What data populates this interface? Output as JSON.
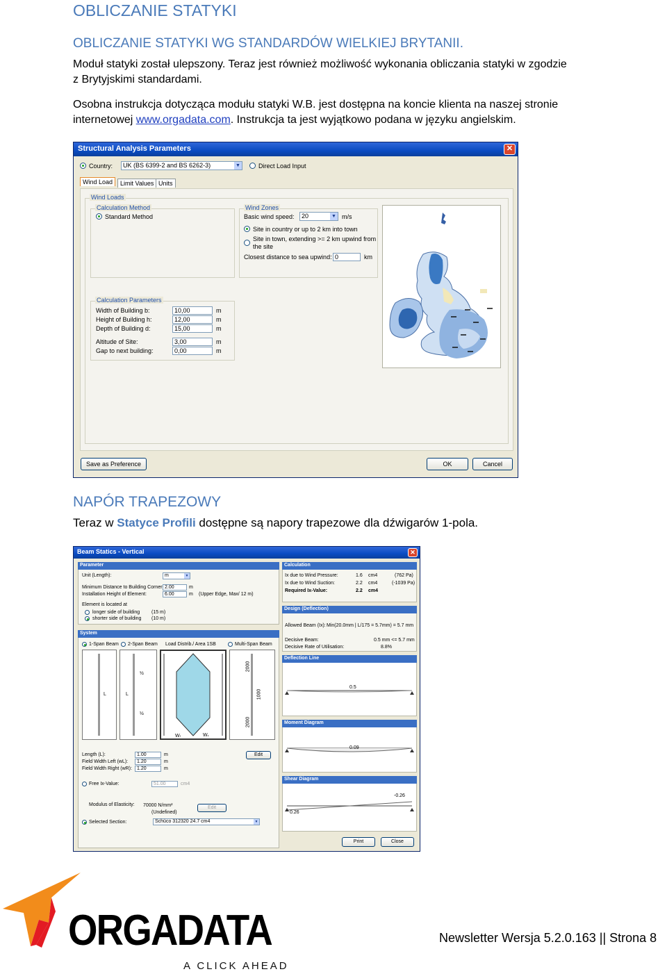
{
  "heading": "OBLICZANIE STATYKI",
  "subheading": "OBLICZANIE STATYKI WG STANDARDÓW WIELKIEJ BRYTANII.",
  "para1_line1": "Moduł statyki został ulepszony. Teraz jest również możliwość wykonania obliczania statyki w zgodzie",
  "para1_line2": "z Brytyjskimi standardami.",
  "para2_line1": "Osobna instrukcja dotycząca modułu statyki W.B. jest dostępna na koncie klienta na naszej stronie",
  "para2_prefix": "internetowej ",
  "para2_link": "www.orgadata.com",
  "para2_suffix": ". Instrukcja ta jest wyjątkowo podana w języku angielskim.",
  "dialog1": {
    "title": "Structural Analysis Parameters",
    "country_label": "Country:",
    "country_value": "UK (BS 6399-2 and BS 6262-3)",
    "direct_load": "Direct Load Input",
    "tabs": [
      "Wind Load",
      "Limit Values",
      "Units"
    ],
    "wind_loads": "Wind Loads",
    "calc_method": "Calculation Method",
    "standard_method": "Standard Method",
    "wind_zones": "Wind Zones",
    "basic_speed_label": "Basic wind speed:",
    "basic_speed_value": "20",
    "basic_speed_unit": "m/s",
    "site_country": "Site in country or up to 2 km into town",
    "site_town_1": "Site in town, extending >= 2 km upwind from",
    "site_town_2": "the site",
    "closest_label": "Closest distance to sea upwind:",
    "closest_value": "0",
    "closest_unit": "km",
    "calc_params": "Calculation Parameters",
    "params": [
      {
        "label": "Width of Building b:",
        "value": "10,00",
        "unit": "m"
      },
      {
        "label": "Height of Building h:",
        "value": "12,00",
        "unit": "m"
      },
      {
        "label": "Depth of Building d:",
        "value": "15,00",
        "unit": "m"
      },
      {
        "label": "Altitude of Site:",
        "value": "3,00",
        "unit": "m"
      },
      {
        "label": "Gap to next building:",
        "value": "0,00",
        "unit": "m"
      }
    ],
    "save_pref": "Save as Preference",
    "ok": "OK",
    "cancel": "Cancel"
  },
  "section2_title": "NAPÓR TRAPEZOWY",
  "section2_prefix": "Teraz w ",
  "section2_highlight": "Statyce Profili",
  "section2_suffix": " dostępne są napory trapezowe dla dźwigarów 1-pola.",
  "dialog2": {
    "title": "Beam Statics - Vertical",
    "parameter": "Parameter",
    "unit_label": "Unit (Length):",
    "unit_value": "m",
    "min_dist_label": "Minimum Distance to Building Corner:",
    "min_dist_value": "2.00",
    "min_dist_unit": "m",
    "install_label": "Installation Height of Element:",
    "install_value": "6.00",
    "install_unit": "m",
    "install_note": "(Upper Edge, Max/ 12 m)",
    "located_label": "Element is located at",
    "longer_side": "longer side of building",
    "longer_val": "(15 m)",
    "shorter_side": "shorter side of building",
    "shorter_val": "(10 m)",
    "system": "System",
    "systems": [
      "1-Span Beam",
      "2-Span Beam",
      "Load Distrib./ Area 1SB",
      "Multi-Span Beam"
    ],
    "length_label": "Length (L):",
    "length_value": "1.00",
    "fwl_label": "Field Width Left (wL):",
    "fwl_value": "1.20",
    "fwr_label": "Field Width Right (wR):",
    "fwr_value": "1.20",
    "unit_m": "m",
    "edit": "Edit",
    "free_ix": "Free Ix-Value:",
    "free_ix_value": "51.00",
    "free_ix_unit": "cm4",
    "modulus_label": "Modulus of Elasticity:",
    "modulus_value": "70000 N/mm²",
    "modulus_note": "(Undefined)",
    "selected_label": "Selected Section:",
    "selected_value": "Schüco 312320 24.7 cm4",
    "calculation": "Calculation",
    "calc_rows": [
      {
        "label": "Ix due to Wind Pressure:",
        "value": "1.6",
        "unit": "cm4",
        "note": "(762 Pa)"
      },
      {
        "label": "Ix due to Wind Suction:",
        "value": "2.2",
        "unit": "cm4",
        "note": "(-1039 Pa)"
      },
      {
        "label": "Required Ix-Value:",
        "value": "2.2",
        "unit": "cm4",
        "note": ""
      }
    ],
    "design": "Design (Deflection)",
    "allowed_label": "Allowed Beam (Ix):",
    "allowed_value": "Min(20.0mm | L/175 = 5.7mm) = 5.7 mm",
    "decisive_beam_label": "Decisive Beam:",
    "decisive_beam_value": "0.5 mm <= 5.7 mm",
    "decisive_rate_label": "Decisive Rate of Utilisation:",
    "decisive_rate_value": "8.8%",
    "deflection": "Deflection Line",
    "deflection_val": "0.5",
    "moment": "Moment Diagram",
    "moment_val": "0.09",
    "shear": "Shear Diagram",
    "shear_val_pos": "-0.26",
    "shear_val_neg": "0.26",
    "dim_2000": "2000",
    "dim_1000": "1000",
    "half": "½",
    "label_L": "L",
    "label_wl": "Wₗ",
    "label_wr": "Wᵣ",
    "print": "Print",
    "close": "Close"
  },
  "logo_text": "ORGADATA",
  "logo_tagline": "A CLICK AHEAD",
  "footer": "Newsletter Wersja 5.2.0.163 || Strona 8"
}
